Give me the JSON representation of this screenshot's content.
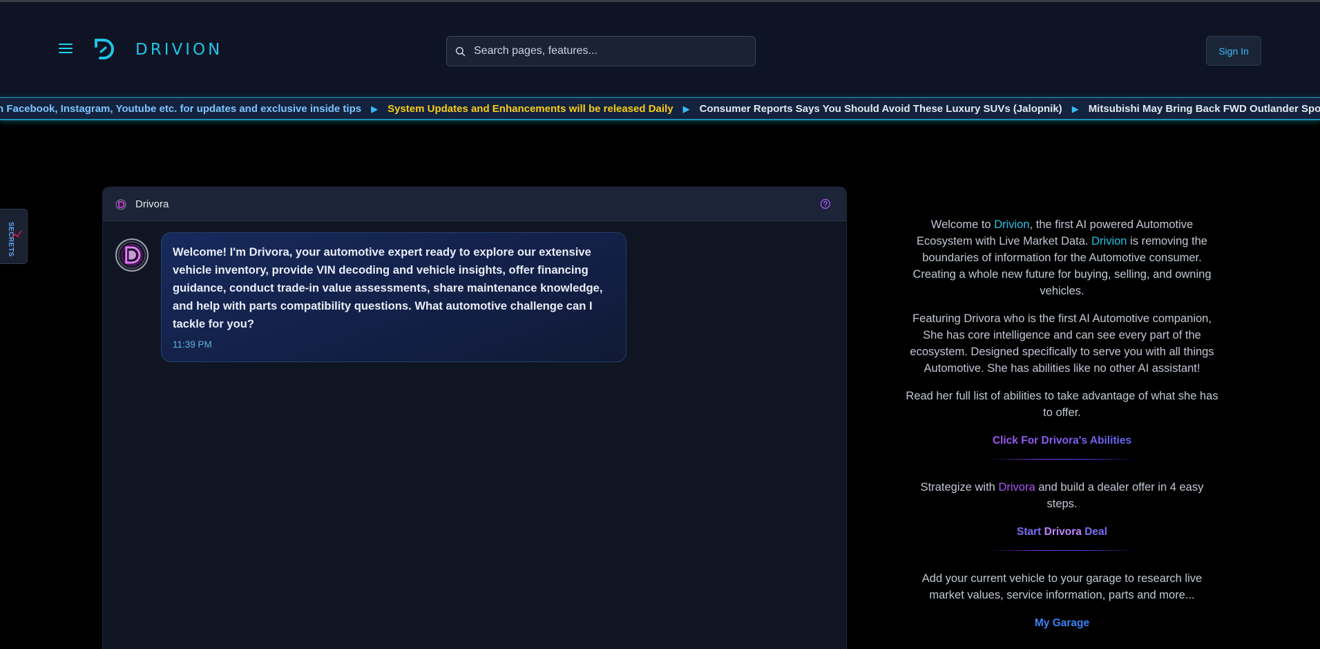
{
  "header": {
    "logo_text": "DRIVION",
    "search_placeholder": "Search pages, features...",
    "signin_label": "Sign In"
  },
  "ticker": {
    "items": [
      {
        "text": "n Facebook, Instagram, Youtube etc. for updates and exclusive inside tips",
        "color": "#7cc4ff"
      },
      {
        "text": "System Updates and Enhancements will be released Daily",
        "color": "#facc15"
      },
      {
        "text": "Consumer Reports Says You Should Avoid These Luxury SUVs (Jalopnik)",
        "color": "#e2e8f0"
      },
      {
        "text": "Mitsubishi May Bring Back FWD Outlander Sport to L",
        "color": "#e2e8f0"
      }
    ],
    "separator": "▶"
  },
  "secrets_tab": {
    "label": "SECRETS"
  },
  "chat": {
    "title": "Drivora",
    "message": {
      "text": "Welcome! I'm Drivora, your automotive expert ready to explore our extensive vehicle inventory, provide VIN decoding and vehicle insights, offer financing guidance, conduct trade-in value assessments, share maintenance knowledge, and help with parts compatibility questions. What automotive challenge can I tackle for you?",
      "time": "11:39 PM"
    }
  },
  "info": {
    "p1_pre": "Welcome to ",
    "p1_brand": "Drivion",
    "p1_mid": ", the first AI powered Automotive Ecosystem with Live Market Data. ",
    "p1_brand2": "Drivion",
    "p1_post": " is removing the boundaries of information for the Automotive consumer. Creating a whole new future for buying, selling, and owning vehicles.",
    "p2": "Featuring Drivora who is the first AI Automotive companion, She has core intelligence and can see every part of the ecosystem. Designed specifically to serve you with all things Automotive. She has abilities like no other AI assistant!",
    "p3": "Read her full list of abilities to take advantage of what she has to offer.",
    "abilities_link": "Click For Drivora's Abilities",
    "p4_pre": "Strategize with ",
    "p4_brand": "Drivora",
    "p4_post": " and build a dealer offer in 4 easy steps.",
    "deal_link_pre": "Start ",
    "deal_link_mid": "Drivora",
    "deal_link_post": " Deal",
    "p5": "Add your current vehicle to your garage to research live market values, service information, parts and more...",
    "garage_link": "My Garage"
  },
  "colors": {
    "accent_cyan": "#22c3e6",
    "accent_purple": "#a855f7",
    "header_bg": "#0e1424",
    "panel_bg": "#0f1522"
  }
}
